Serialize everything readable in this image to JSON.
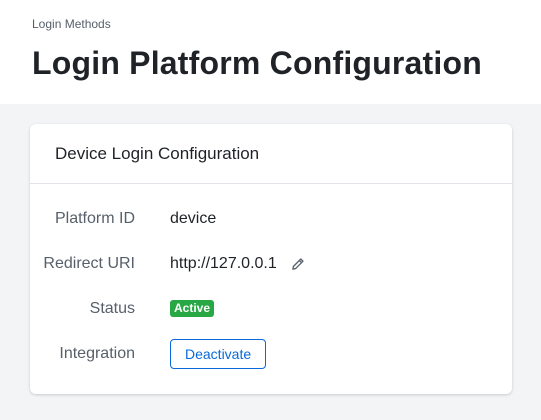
{
  "breadcrumb": "Login Methods",
  "page_title": "Login Platform Configuration",
  "card": {
    "title": "Device Login Configuration",
    "rows": [
      {
        "label": "Platform ID",
        "value": "device"
      },
      {
        "label": "Redirect URI",
        "value": "http://127.0.0.1",
        "icon": "pencil-icon"
      },
      {
        "label": "Status",
        "value": "Active"
      },
      {
        "label": "Integration",
        "value": "Deactivate"
      }
    ]
  },
  "colors": {
    "accent": "#0969da",
    "status_active": "#28a745",
    "page_bg": "#f3f4f6"
  }
}
